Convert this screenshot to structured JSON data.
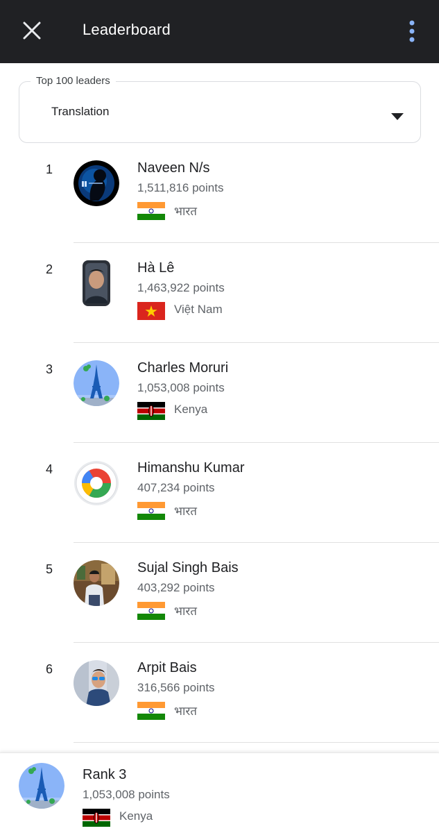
{
  "appbar": {
    "title": "Leaderboard",
    "close_icon": "close-icon",
    "menu_icon": "more-vert-icon",
    "background": "#202124",
    "menu_color": "#8ab4f8"
  },
  "filter": {
    "legend": "Top 100 leaders",
    "selected": "Translation",
    "arrow_icon": "dropdown-arrow-icon"
  },
  "leaders": [
    {
      "rank": "1",
      "name": "Naveen N/s",
      "points": "1,511,816 points",
      "country": "भारत",
      "flag": "india-flag-icon",
      "avatar": "dark-silhouette-avatar"
    },
    {
      "rank": "2",
      "name": "Hà Lê",
      "points": "1,463,922 points",
      "country": "Việt Nam",
      "flag": "vietnam-flag-icon",
      "avatar": "photo-avatar"
    },
    {
      "rank": "3",
      "name": "Charles Moruri",
      "points": "1,053,008 points",
      "country": "Kenya",
      "flag": "kenya-flag-icon",
      "avatar": "eiffel-tower-avatar"
    },
    {
      "rank": "4",
      "name": "Himanshu Kumar",
      "points": "407,234 points",
      "country": "भारत",
      "flag": "india-flag-icon",
      "avatar": "camera-lens-avatar"
    },
    {
      "rank": "5",
      "name": "Sujal Singh Bais",
      "points": "403,292 points",
      "country": "भारत",
      "flag": "india-flag-icon",
      "avatar": "photo-avatar"
    },
    {
      "rank": "6",
      "name": "Arpit Bais",
      "points": "316,566 points",
      "country": "भारत",
      "flag": "india-flag-icon",
      "avatar": "photo-avatar"
    }
  ],
  "my_rank": {
    "label": "Rank 3",
    "points": "1,053,008 points",
    "country": "Kenya",
    "flag": "kenya-flag-icon",
    "avatar": "eiffel-tower-avatar"
  }
}
